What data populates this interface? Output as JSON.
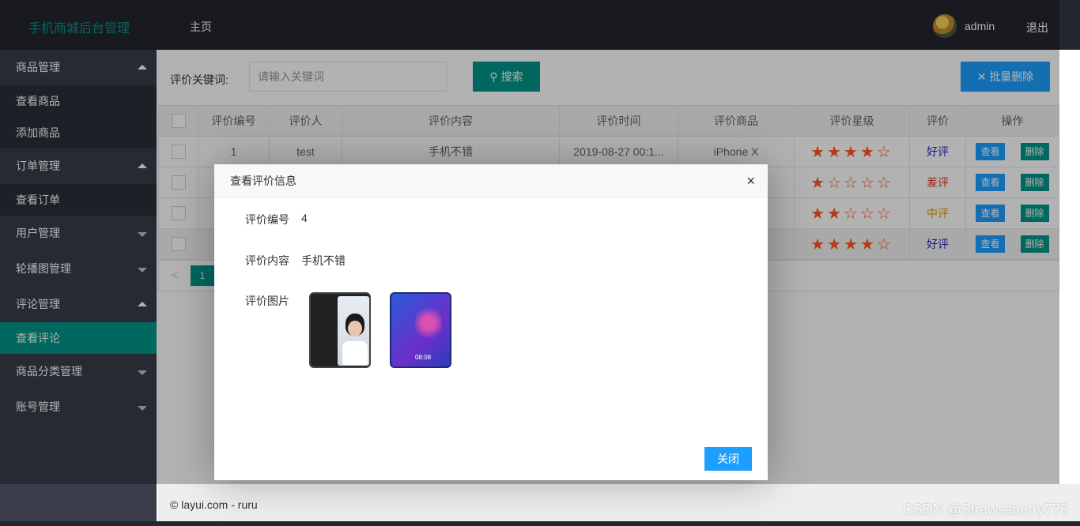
{
  "header": {
    "logo": "手机商城后台管理",
    "nav_home": "主页",
    "username": "admin",
    "logout": "退出"
  },
  "sidebar": {
    "groups": [
      {
        "label": "商品管理",
        "items": [
          "查看商品",
          "添加商品"
        ]
      },
      {
        "label": "订单管理",
        "items": [
          "查看订单"
        ]
      },
      {
        "label": "用户管理"
      },
      {
        "label": "轮播图管理"
      },
      {
        "label": "评论管理",
        "items": [
          "查看评论"
        ]
      },
      {
        "label": "商品分类管理"
      },
      {
        "label": "账号管理"
      }
    ]
  },
  "toolbar": {
    "keyword_label": "评价关键词:",
    "search_placeholder": "请输入关键词",
    "search_button": "搜索",
    "batch_delete_button": "批量删除"
  },
  "table": {
    "columns": [
      "评价编号",
      "评价人",
      "评价内容",
      "评价时间",
      "评价商品",
      "评价星级",
      "评价",
      "操作"
    ],
    "rows": [
      {
        "id": "1",
        "user": "test",
        "content": "手机不错",
        "time": "2019-08-27 00:1...",
        "product": "iPhone X",
        "stars": 4,
        "stars_text": "★★★★☆",
        "rating": "好评",
        "rating_class": "good"
      },
      {
        "id": "",
        "user": "",
        "content": "",
        "time": "",
        "product": "",
        "stars": 1,
        "stars_text": "★☆☆☆☆",
        "rating": "差评",
        "rating_class": "bad"
      },
      {
        "id": "",
        "user": "",
        "content": "",
        "time": "",
        "product": "",
        "stars": 2,
        "stars_text": "★★☆☆☆",
        "rating": "中评",
        "rating_class": "mid"
      },
      {
        "id": "",
        "user": "",
        "content": "",
        "time": "",
        "product": "",
        "stars": 4,
        "stars_text": "★★★★☆",
        "rating": "好评",
        "rating_class": "good"
      }
    ],
    "view_label": "查看",
    "delete_label": "删除"
  },
  "pager": {
    "prev": "<",
    "current": "1"
  },
  "footer": {
    "copyright": "© layui.com - ruru",
    "watermark": "CSDN @Strawssberry778"
  },
  "modal": {
    "title": "查看评价信息",
    "close_x": "×",
    "id_label": "评价编号",
    "id_value": "4",
    "content_label": "评价内容",
    "content_value": "手机不错",
    "images_label": "评价图片",
    "image2_time": "08:08",
    "close_button": "关闭"
  },
  "colors": {
    "header_bg": "#23262e",
    "sidebar_bg": "#393d49",
    "accent_green": "#009688",
    "accent_blue": "#1e9fff",
    "star": "#ff5722"
  }
}
